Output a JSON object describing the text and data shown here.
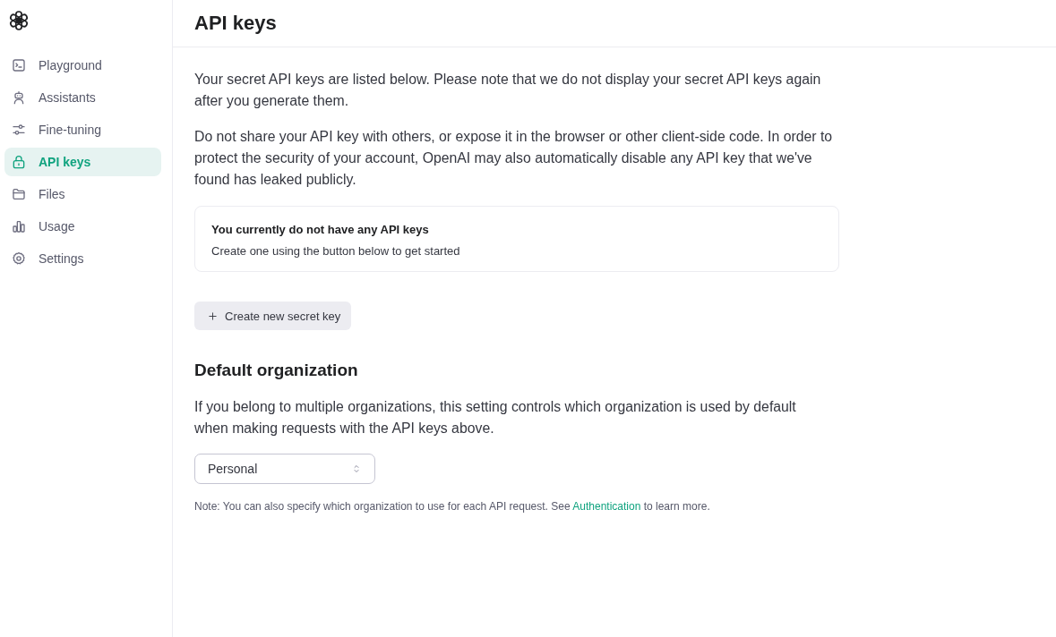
{
  "sidebar": {
    "items": [
      {
        "label": "Playground",
        "kind": "terminal",
        "selected": false
      },
      {
        "label": "Assistants",
        "kind": "robot",
        "selected": false
      },
      {
        "label": "Fine-tuning",
        "kind": "sliders",
        "selected": false
      },
      {
        "label": "API keys",
        "kind": "lock",
        "selected": true
      },
      {
        "label": "Files",
        "kind": "folder",
        "selected": false
      },
      {
        "label": "Usage",
        "kind": "chart",
        "selected": false
      },
      {
        "label": "Settings",
        "kind": "gear",
        "selected": false
      }
    ]
  },
  "header": {
    "title": "API keys"
  },
  "intro": [
    "Your secret API keys are listed below. Please note that we do not display your secret API keys again after you generate them.",
    "Do not share your API key with others, or expose it in the browser or other client-side code. In order to protect the security of your account, OpenAI may also automatically disable any API key that we've found has leaked publicly."
  ],
  "empty_state": {
    "title": "You currently do not have any API keys",
    "text": "Create one using the button below to get started"
  },
  "create_button": {
    "label": "Create new secret key"
  },
  "default_organization": {
    "heading": "Default organization",
    "text": "If you belong to multiple organizations, this setting controls which organization is used by default when making requests with the API keys above.",
    "select": {
      "value": "Personal"
    },
    "note": {
      "before": "Note: You can also specify which organization to use for each API request. See",
      "link": "Authentication",
      "after": "to learn more."
    }
  }
}
